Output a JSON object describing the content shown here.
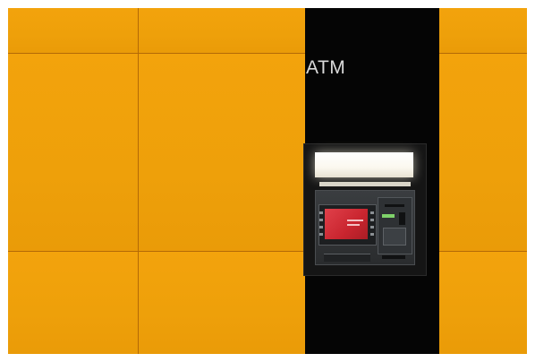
{
  "scene": {
    "sign_text": "ATM",
    "colors": {
      "wall": "#f2a20b",
      "column": "#050505",
      "screen": "#d0303a",
      "sign": "#d9d9d9"
    }
  }
}
